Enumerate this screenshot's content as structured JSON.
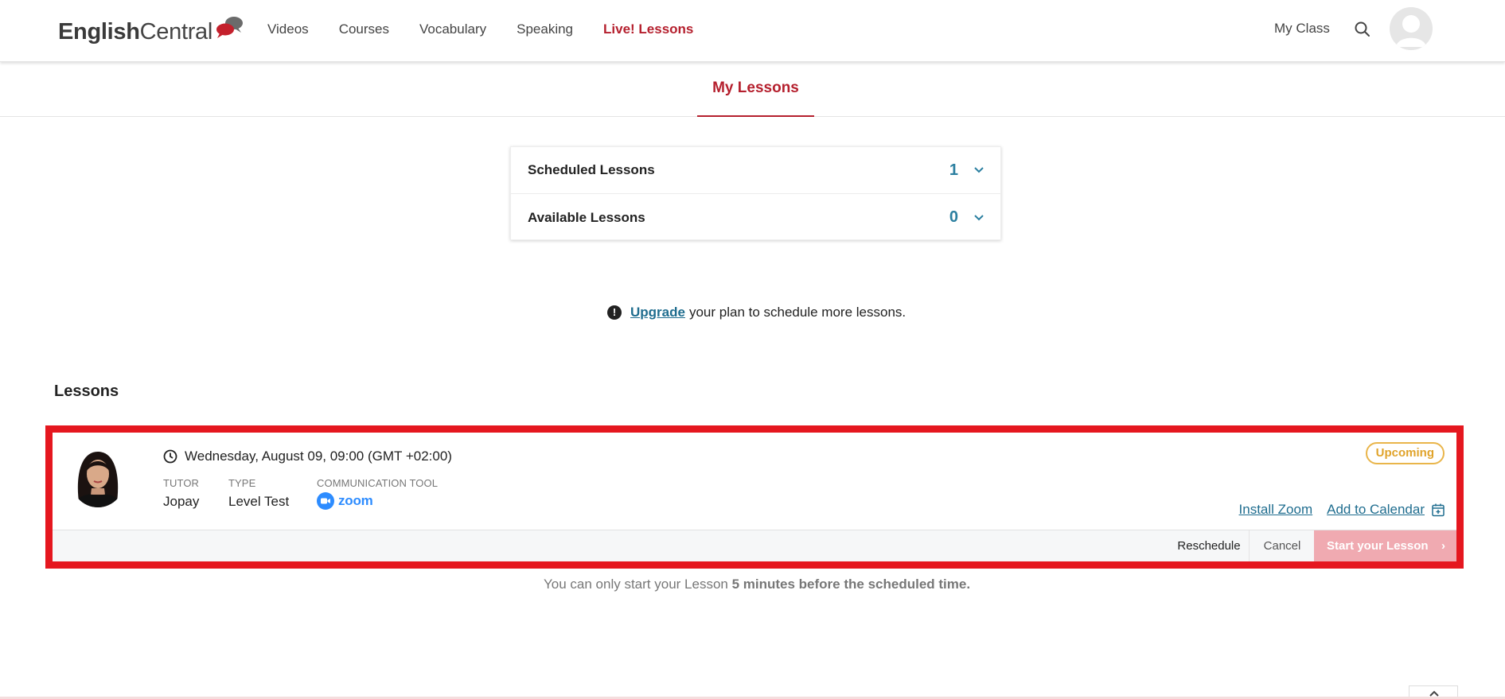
{
  "header": {
    "logo_text_bold": "English",
    "logo_text_rest": "Central",
    "nav": [
      "Videos",
      "Courses",
      "Vocabulary",
      "Speaking",
      "Live! Lessons"
    ],
    "my_class": "My Class",
    "accent_color": "#b5202e"
  },
  "tabs": {
    "my_lessons": "My Lessons"
  },
  "summary": {
    "scheduled_label": "Scheduled Lessons",
    "scheduled_count": "1",
    "available_label": "Available Lessons",
    "available_count": "0"
  },
  "notice": {
    "link": "Upgrade",
    "text": "your plan to schedule more lessons."
  },
  "lessons": {
    "title": "Lessons",
    "items": [
      {
        "datetime": "Wednesday, August 09, 09:00 (GMT +02:00)",
        "tutor_label": "TUTOR",
        "tutor": "Jopay",
        "type_label": "TYPE",
        "type": "Level Test",
        "tool_label": "COMMUNICATION TOOL",
        "tool": "zoom",
        "status": "Upcoming",
        "install_link": "Install Zoom",
        "calendar_link": "Add to Calendar",
        "reschedule": "Reschedule",
        "cancel": "Cancel",
        "start": "Start your Lesson"
      }
    ]
  },
  "footnote": {
    "text": "You can only start your Lesson",
    "bold": "5 minutes before the scheduled time."
  }
}
